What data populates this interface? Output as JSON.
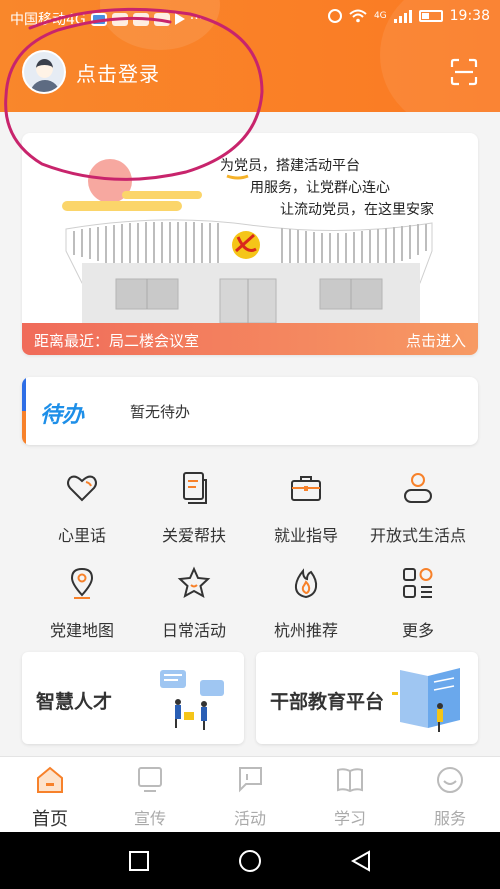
{
  "status_bar": {
    "carrier": "中国移动4G",
    "network": "4G",
    "time": "19:38"
  },
  "header": {
    "login_text": "点击登录",
    "avatar_icon": "user-avatar-icon",
    "scan_icon": "scan-icon",
    "background_color": "#f9872b"
  },
  "banner": {
    "slogan_lines": [
      "为党员，搭建活动平台",
      "用服务，让党群心连心",
      "让流动党员，在这里安家"
    ],
    "distance_text": "距离最近：局二楼会议室",
    "enter_text": "点击进入"
  },
  "todo": {
    "logo_text": "待办",
    "status_text": "暂无待办"
  },
  "features": [
    {
      "label": "心里话",
      "icon": "heart-icon"
    },
    {
      "label": "关爱帮扶",
      "icon": "document-icon"
    },
    {
      "label": "就业指导",
      "icon": "briefcase-icon"
    },
    {
      "label": "开放式生活点",
      "icon": "person-icon"
    },
    {
      "label": "党建地图",
      "icon": "map-pin-icon"
    },
    {
      "label": "日常活动",
      "icon": "star-icon"
    },
    {
      "label": "杭州推荐",
      "icon": "flame-icon"
    },
    {
      "label": "更多",
      "icon": "grid-more-icon"
    }
  ],
  "cards": [
    {
      "title": "智慧人才"
    },
    {
      "title": "干部教育平台"
    }
  ],
  "tabs": [
    {
      "label": "首页",
      "icon": "home-icon",
      "active": true
    },
    {
      "label": "宣传",
      "icon": "monitor-icon",
      "active": false
    },
    {
      "label": "活动",
      "icon": "chat-flag-icon",
      "active": false
    },
    {
      "label": "学习",
      "icon": "book-icon",
      "active": false
    },
    {
      "label": "服务",
      "icon": "smile-icon",
      "active": false
    }
  ],
  "colors": {
    "accent": "#f9872b",
    "banner_bar": "#f06b5a",
    "todo_blue": "#1e8fe8",
    "annotation": "#c8246c"
  }
}
